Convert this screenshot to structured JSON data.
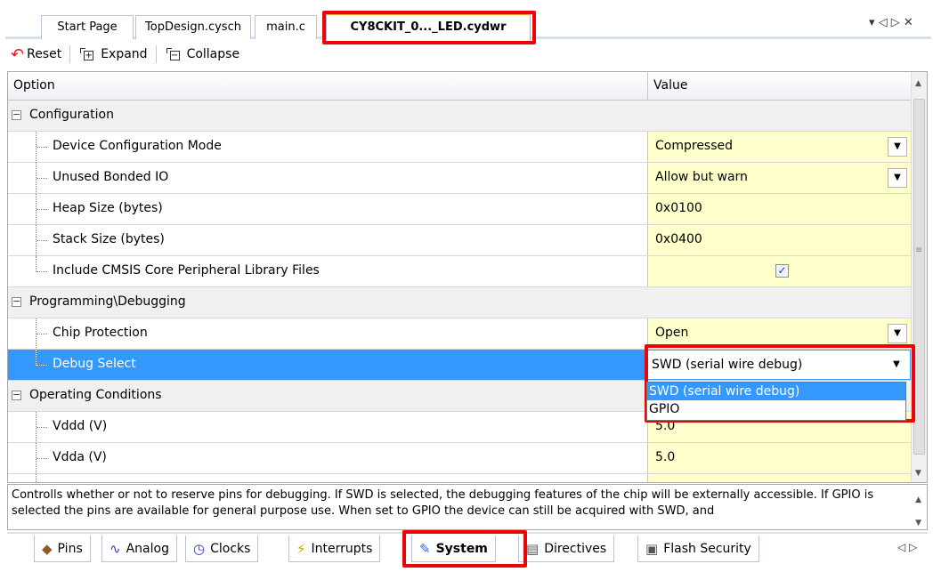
{
  "doc_tabs": {
    "start_page": "Start Page",
    "top_design": "TopDesign.cysch",
    "main_c": "main.c",
    "active": "CY8CKIT_0..._LED.cydwr",
    "controls": "▾ ◁ ▷ ✕"
  },
  "toolbar": {
    "reset": "Reset",
    "expand": "Expand",
    "collapse": "Collapse"
  },
  "grid": {
    "col_option": "Option",
    "col_value": "Value",
    "categories": [
      "Configuration",
      "Programming\\Debugging",
      "Operating Conditions"
    ],
    "rows": [
      {
        "label": "Device Configuration Mode",
        "value": "Compressed"
      },
      {
        "label": "Unused Bonded IO",
        "value": "Allow but warn"
      },
      {
        "label": "Heap Size (bytes)",
        "value": "0x0100"
      },
      {
        "label": "Stack Size (bytes)",
        "value": "0x0400"
      },
      {
        "label": "Include CMSIS Core Peripheral Library Files",
        "value": "✓"
      },
      {
        "label": "Chip Protection",
        "value": "Open"
      },
      {
        "label": "Debug Select",
        "value": "SWD (serial wire debug)"
      },
      {
        "label": "Vddd (V)",
        "value": "5.0"
      },
      {
        "label": "Vdda (V)",
        "value": "5.0"
      }
    ],
    "dropdown_options": [
      "SWD (serial wire debug)",
      "GPIO"
    ]
  },
  "description": "Controlls whether or not to reserve pins for debugging. If SWD is selected, the debugging features of the chip will be externally accessible. If GPIO is selected the pins are available for general purpose use. When set to GPIO the device can still be acquired with SWD, and",
  "bottom_tabs": [
    "Pins",
    "Analog",
    "Clocks",
    "Interrupts",
    "System",
    "Directives",
    "Flash Security"
  ],
  "bottom_nav": "◁ ▷",
  "colors": {
    "selection": "#3399ff",
    "value_bg": "#ffffcc",
    "highlight_box": "#e8060a"
  }
}
